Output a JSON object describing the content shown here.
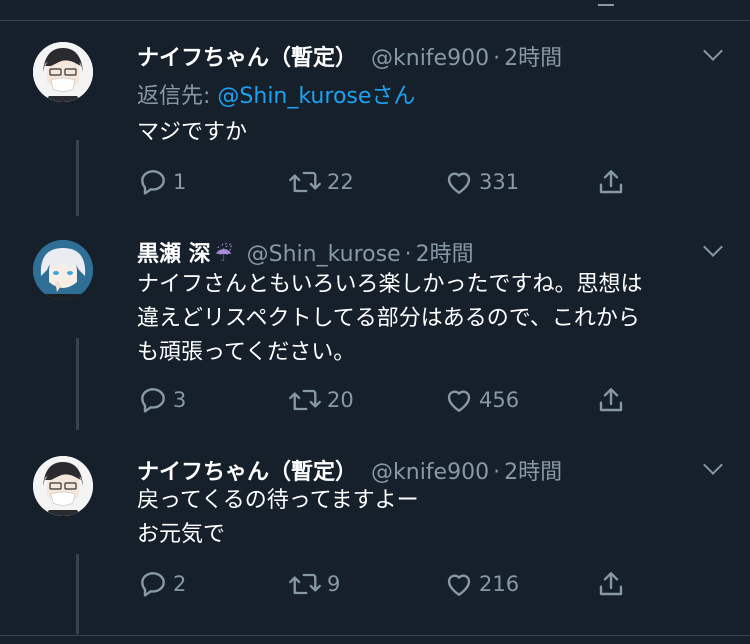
{
  "tweets": [
    {
      "name": "ナイフちゃん（暫定）",
      "handle": "@knife900",
      "sep": "·",
      "time": "2時間",
      "reply_prefix": "返信先: ",
      "reply_mention": "@Shin_kurose",
      "reply_suffix": "さん",
      "text": "マジですか",
      "replies": "1",
      "retweets": "22",
      "likes": "331"
    },
    {
      "name": "黒瀬 深",
      "emoji": "☔",
      "handle": "@Shin_kurose",
      "sep": "·",
      "time": "2時間",
      "text_line1": "ナイフさんともいろいろ楽しかったですね。思想は",
      "text_line2": "違えどリスペクトしてる部分はあるので、これから",
      "text_line3": "も頑張ってください。",
      "replies": "3",
      "retweets": "20",
      "likes": "456"
    },
    {
      "name": "ナイフちゃん（暫定）",
      "handle": "@knife900",
      "sep": "·",
      "time": "2時間",
      "text_line1": "戻ってくるの待ってますよー",
      "text_line2": "お元気で",
      "replies": "2",
      "retweets": "9",
      "likes": "216"
    }
  ],
  "colors": {
    "background": "#15202b",
    "secondary_text": "#8899a6",
    "mention": "#1da1f2",
    "divider": "#38444d"
  },
  "icons": [
    "reply-icon",
    "retweet-icon",
    "like-icon",
    "share-icon",
    "chevron-down-icon"
  ]
}
